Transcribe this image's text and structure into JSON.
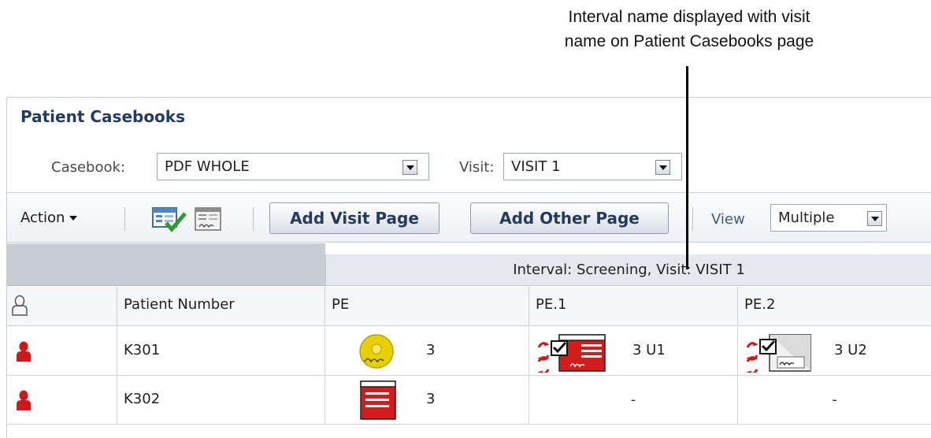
{
  "callout": {
    "line1": "Interval name displayed with visit",
    "line2": "name on Patient Casebooks page"
  },
  "panel": {
    "title": "Patient Casebooks",
    "casebook_label": "Casebook:",
    "casebook_value": "PDF WHOLE",
    "visit_label": "Visit:",
    "visit_value": "VISIT 1"
  },
  "toolbar": {
    "action_label": "Action",
    "add_visit_page": "Add Visit Page",
    "add_other_page": "Add Other Page",
    "view_label": "View",
    "view_value": "Multiple"
  },
  "grid": {
    "interval_header": "Interval: Screening, Visit: VISIT 1",
    "columns": [
      "Patient Number",
      "PE",
      "PE.1",
      "PE.2"
    ],
    "rows": [
      {
        "patient": "K301",
        "pe": "3",
        "pe1": "3 U1",
        "pe2": "3 U2"
      },
      {
        "patient": "K302",
        "pe": "3",
        "pe1": "-",
        "pe2": "-"
      }
    ]
  },
  "colors": {
    "title": "#223b61",
    "patient_icon": "#d01818",
    "crf_red": "#d71a1a",
    "sdv_yellow": "#e8d000"
  }
}
